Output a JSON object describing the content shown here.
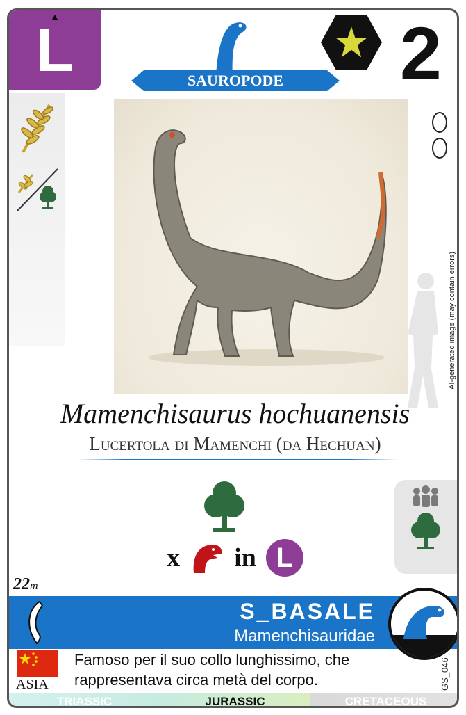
{
  "card": {
    "size_letter": "L",
    "group_banner": "SAUROPODE",
    "cost_number": "2",
    "scientific_name": "Mamenchisaurus hochuanensis",
    "common_name": "Lucertola di Mamenchi (da Hechuan)",
    "requirement_multiplier": "x",
    "requirement_connector": "in",
    "requirement_size": "L",
    "length_value": "22",
    "length_unit": "m",
    "clade": "S_BASALE",
    "family": "Mamenchisauridae",
    "region": "ASIA",
    "description": "Famoso per il suo collo lunghissimo, che rappresentava circa metà del corpo.",
    "code": "GS_046",
    "ai_note": "AI-generated image (may contain errors)"
  },
  "periods": [
    "TRIASSIC",
    "JURASSIC",
    "CRETACEOUS"
  ],
  "colors": {
    "size": "#8e3d96",
    "accent": "#1a75c9",
    "tree": "#2e6b3e",
    "predator": "#c0141a",
    "flag": "#de2910"
  },
  "icons": [
    "sauropod-icon",
    "star-hexagon-icon",
    "fern-icon",
    "tree-icon",
    "egg-icon",
    "herd-icon",
    "predator-icon",
    "claw-icon",
    "flag-china-icon",
    "human-silhouette-icon"
  ]
}
